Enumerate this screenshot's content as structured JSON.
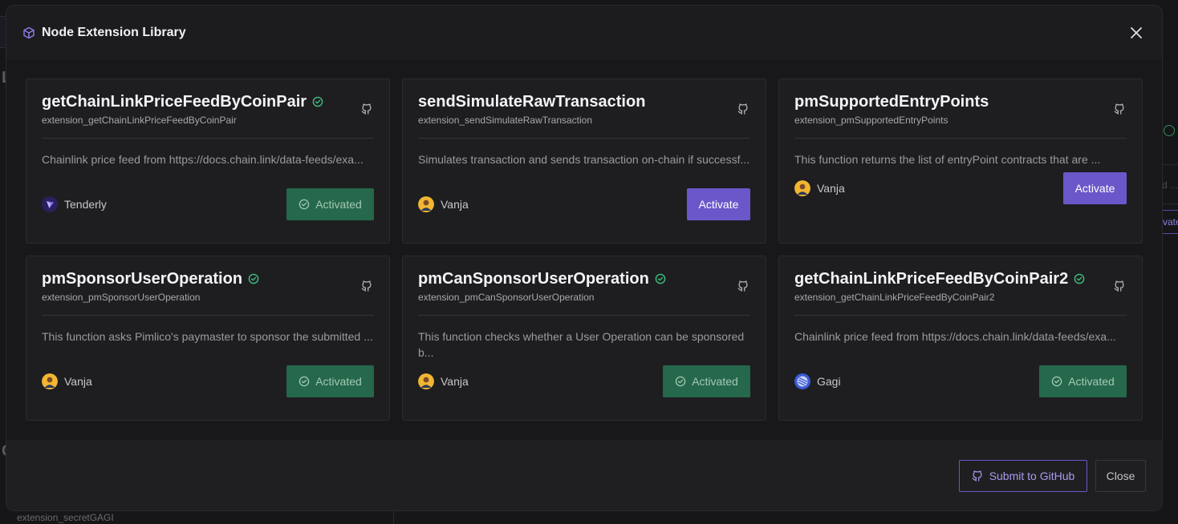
{
  "modal": {
    "title": "Node Extension Library",
    "icon": "cube-icon",
    "close_icon": "close-icon"
  },
  "extensions": [
    {
      "name": "getChainLinkPriceFeedByCoinPair",
      "slug": "extension_getChainLinkPriceFeedByCoinPair",
      "verified": true,
      "description": "Chainlink price feed from https://docs.chain.link/data-feeds/exa...",
      "author": "Tenderly",
      "avatar": "tenderly",
      "status": "Activated"
    },
    {
      "name": "sendSimulateRawTransaction",
      "slug": "extension_sendSimulateRawTransaction",
      "verified": false,
      "description": "Simulates transaction and sends transaction on-chain if successf...",
      "author": "Vanja",
      "avatar": "vanja",
      "status": "Activate"
    },
    {
      "name": "pmSupportedEntryPoints",
      "slug": "extension_pmSupportedEntryPoints",
      "verified": false,
      "description": "This function returns the list of entryPoint contracts that are ...",
      "author": "Vanja",
      "avatar": "vanja",
      "status": "Activate"
    },
    {
      "name": "pmSponsorUserOperation",
      "slug": "extension_pmSponsorUserOperation",
      "verified": true,
      "description": "This function asks Pimlico's paymaster to sponsor the submitted ...",
      "author": "Vanja",
      "avatar": "vanja",
      "status": "Activated"
    },
    {
      "name": "pmCanSponsorUserOperation",
      "slug": "extension_pmCanSponsorUserOperation",
      "verified": true,
      "description": "This function checks whether a User Operation can be sponsored b...",
      "author": "Vanja",
      "avatar": "vanja",
      "status": "Activated"
    },
    {
      "name": "getChainLinkPriceFeedByCoinPair2",
      "slug": "extension_getChainLinkPriceFeedByCoinPair2",
      "verified": true,
      "description": "Chainlink price feed from https://docs.chain.link/data-feeds/exa...",
      "author": "Gagi",
      "avatar": "gagi",
      "status": "Activated"
    }
  ],
  "footer": {
    "submit_label": "Submit to GitHub",
    "close_label": "Close"
  },
  "background": {
    "left_letter_1": "L",
    "left_letter_2": "C",
    "footer_text": "extension_secretGAGI",
    "right_field_text": "d ...",
    "right_button_text": "vate"
  },
  "colors": {
    "accent": "#6b57c9",
    "activated": "#25684b",
    "verified": "#3fbf7f"
  }
}
